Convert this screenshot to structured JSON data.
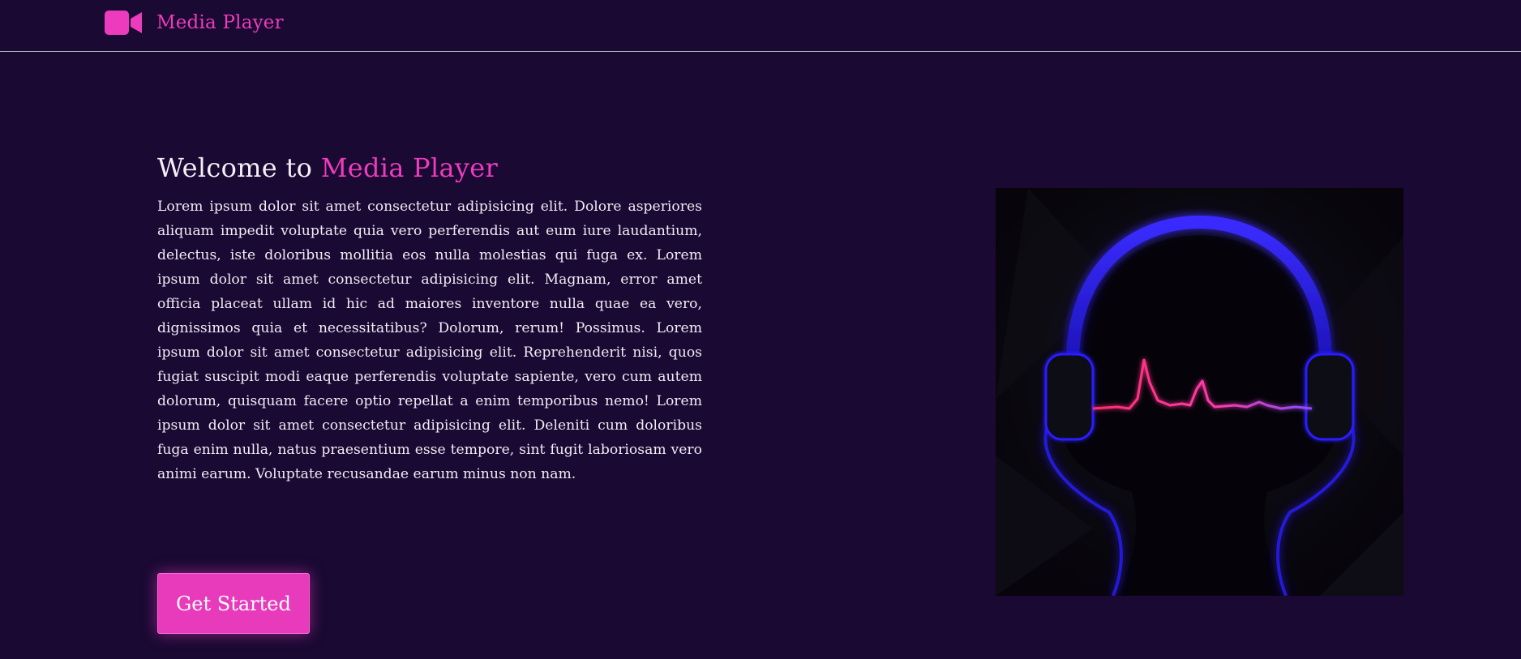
{
  "navbar": {
    "brand_name": "Media Player",
    "brand_icon": "video-camera-icon"
  },
  "hero": {
    "title_prefix": "Welcome to",
    "title_accent": "Media Player",
    "description": "Lorem ipsum dolor sit amet consectetur adipisicing elit. Dolore asperiores aliquam impedit voluptate quia vero perferendis aut eum iure laudantium, delectus, iste doloribus mollitia eos nulla molestias qui fuga ex. Lorem ipsum dolor sit amet consectetur adipisicing elit. Magnam, error amet officia placeat ullam id hic ad maiores inventore nulla quae ea vero, dignissimos quia et necessitatibus? Dolorum, rerum! Possimus. Lorem ipsum dolor sit amet consectetur adipisicing elit. Reprehenderit nisi, quos fugiat suscipit modi eaque perferendis voluptate sapiente, vero cum autem dolorum, quisquam facere optio repellat a enim temporibus nemo! Lorem ipsum dolor sit amet consectetur adipisicing elit. Deleniti cum doloribus fuga enim nulla, natus praesentium esse tempore, sint fugit laboriosam vero animi earum. Voluptate recusandae earum minus non nam.",
    "cta_label": "Get Started",
    "image_subject": "headphones-heartbeat-illustration"
  },
  "colors": {
    "background": "#1a0933",
    "accent": "#ec3cbd",
    "text": "#f2ecf4",
    "divider": "#9fb7b0"
  }
}
